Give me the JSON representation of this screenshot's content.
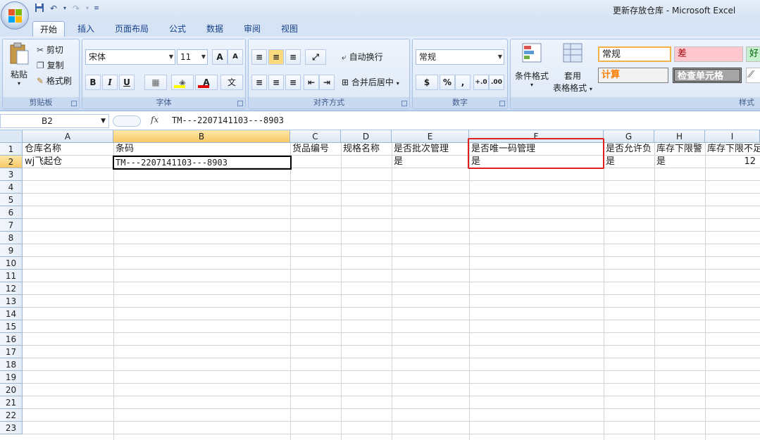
{
  "window": {
    "title": "更新存放仓库 - Microsoft Excel"
  },
  "tabs": [
    "开始",
    "插入",
    "页面布局",
    "公式",
    "数据",
    "审阅",
    "视图"
  ],
  "clipboard": {
    "paste": "粘贴",
    "cut": "剪切",
    "copy": "复制",
    "format_painter": "格式刷",
    "label": "剪贴板"
  },
  "font": {
    "name": "宋体",
    "size": "11",
    "grow": "A",
    "shrink": "A",
    "bold": "B",
    "italic": "I",
    "underline": "U",
    "text_color": "A",
    "phonetic": "文",
    "label": "字体"
  },
  "alignment": {
    "wrap": "自动换行",
    "merge": "合并后居中",
    "label": "对齐方式"
  },
  "number": {
    "format": "常规",
    "percent": "%",
    "comma": ",",
    "inc": "+.0",
    "dec": ".00",
    "label": "数字"
  },
  "styles": {
    "conditional": "条件格式",
    "table_format_line1": "套用",
    "table_format_line2": "表格格式",
    "normal": "常规",
    "bad": "差",
    "good": "好",
    "calc": "计算",
    "check": "检查单元格",
    "label": "样式"
  },
  "formula_bar": {
    "name_box": "B2",
    "fx": "fx",
    "value": "TM---2207141103---8903"
  },
  "columns": [
    "A",
    "B",
    "C",
    "D",
    "E",
    "F",
    "G",
    "H",
    "I"
  ],
  "rows": [
    "1",
    "2",
    "3",
    "4",
    "5",
    "6",
    "7",
    "8",
    "9",
    "10",
    "11",
    "12",
    "13",
    "14",
    "15",
    "16",
    "17",
    "18",
    "19",
    "20",
    "21",
    "22",
    "23"
  ],
  "sheet": {
    "row1": [
      "仓库名称",
      "条码",
      "货品编号",
      "规格名称",
      "是否批次管理",
      "是否唯一码管理",
      "是否允许负",
      "库存下限警",
      "库存下限不足"
    ],
    "row2": [
      "wj飞起仓",
      "TM---2207141103---8903",
      "",
      "",
      "是",
      "是",
      "是",
      "是",
      "12"
    ]
  }
}
